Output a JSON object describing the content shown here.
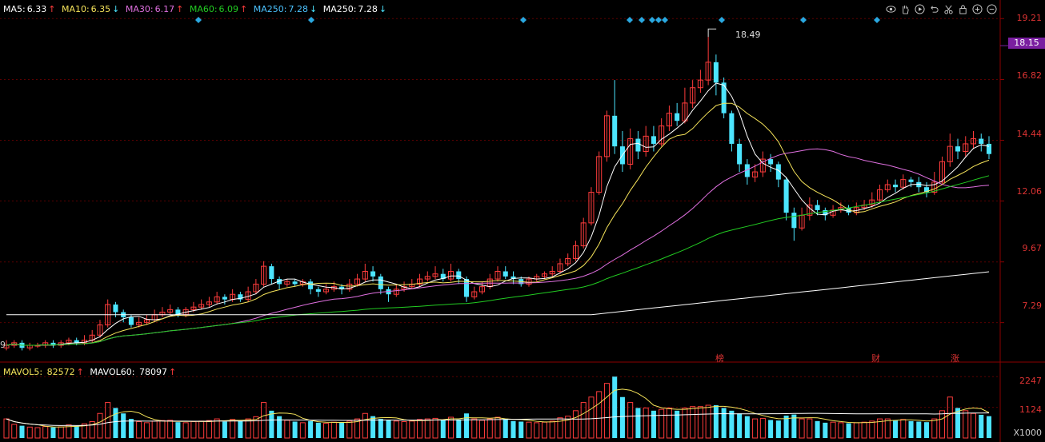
{
  "legend_top": {
    "ma5": {
      "label": "MA5:",
      "value": "6.33",
      "arrow": "↑",
      "color": "#ffffff"
    },
    "ma10": {
      "label": "MA10:",
      "value": "6.35",
      "arrow": "↓",
      "color": "#f5e35a"
    },
    "ma30": {
      "label": "MA30:",
      "value": "6.17",
      "arrow": "↑",
      "color": "#e070e0"
    },
    "ma60": {
      "label": "MA60:",
      "value": "6.09",
      "arrow": "↑",
      "color": "#22cc22"
    },
    "ma250a": {
      "label": "MA250:",
      "value": "7.28",
      "arrow": "↓",
      "color": "#4cc3ff"
    },
    "ma250b": {
      "label": "MA250:",
      "value": "7.28",
      "arrow": "↓",
      "color": "#ffffff"
    }
  },
  "legend_vol": {
    "mavol5": {
      "label": "MAVOL5:",
      "value": "82572",
      "arrow": "↑",
      "color": "#f5e35a"
    },
    "mavol60": {
      "label": "MAVOL60:",
      "value": "78097",
      "arrow": "↑",
      "color": "#ffffff"
    }
  },
  "price_axis": [
    "19.21",
    "16.82",
    "14.44",
    "12.06",
    "9.67",
    "7.29"
  ],
  "current_price": "18.15",
  "high_label": "18.49",
  "left_edge_label": "9",
  "volume_axis": [
    "2247",
    "1124"
  ],
  "volume_unit": "X1000",
  "event_markers": [
    "榜",
    "财",
    "涨"
  ],
  "toolbar_icons": [
    "eye-icon",
    "hand-icon",
    "play-icon",
    "undo-icon",
    "scissors-icon",
    "lock-icon",
    "zoom-in-icon",
    "zoom-out-icon"
  ],
  "colors": {
    "up": "#ff3c3c",
    "down": "#4ce5ff",
    "grid": "#5a0000",
    "axis": "#8b0000"
  },
  "chart_data": {
    "type": "candlestick",
    "price_range": [
      5.9,
      19.5
    ],
    "volume_range": [
      0,
      2400
    ],
    "candles": [
      [
        6.3,
        6.4,
        6.6,
        6.2,
        700
      ],
      [
        6.4,
        6.5,
        6.6,
        6.3,
        500
      ],
      [
        6.5,
        6.3,
        6.6,
        6.2,
        450
      ],
      [
        6.3,
        6.4,
        6.5,
        6.2,
        400
      ],
      [
        6.4,
        6.4,
        6.5,
        6.3,
        380
      ],
      [
        6.4,
        6.5,
        6.6,
        6.3,
        420
      ],
      [
        6.5,
        6.4,
        6.6,
        6.3,
        390
      ],
      [
        6.4,
        6.5,
        6.6,
        6.3,
        410
      ],
      [
        6.5,
        6.6,
        6.7,
        6.4,
        480
      ],
      [
        6.6,
        6.5,
        6.7,
        6.4,
        430
      ],
      [
        6.5,
        6.6,
        6.8,
        6.4,
        520
      ],
      [
        6.6,
        6.8,
        7.0,
        6.5,
        600
      ],
      [
        6.8,
        7.2,
        7.4,
        6.7,
        900
      ],
      [
        7.2,
        8.0,
        8.2,
        7.1,
        1300
      ],
      [
        8.0,
        7.7,
        8.1,
        7.5,
        1100
      ],
      [
        7.7,
        7.5,
        7.8,
        7.3,
        900
      ],
      [
        7.5,
        7.2,
        7.6,
        7.1,
        700
      ],
      [
        7.2,
        7.3,
        7.5,
        7.1,
        600
      ],
      [
        7.3,
        7.4,
        7.6,
        7.2,
        560
      ],
      [
        7.4,
        7.6,
        7.8,
        7.3,
        620
      ],
      [
        7.6,
        7.7,
        7.9,
        7.5,
        640
      ],
      [
        7.7,
        7.8,
        8.0,
        7.6,
        650
      ],
      [
        7.8,
        7.6,
        7.9,
        7.5,
        580
      ],
      [
        7.6,
        7.8,
        7.9,
        7.5,
        560
      ],
      [
        7.8,
        7.9,
        8.1,
        7.7,
        600
      ],
      [
        7.9,
        8.0,
        8.2,
        7.8,
        620
      ],
      [
        8.0,
        8.1,
        8.3,
        7.9,
        640
      ],
      [
        8.1,
        8.3,
        8.5,
        8.0,
        700
      ],
      [
        8.3,
        8.2,
        8.4,
        8.0,
        600
      ],
      [
        8.2,
        8.4,
        8.6,
        8.1,
        680
      ],
      [
        8.4,
        8.2,
        8.5,
        8.1,
        620
      ],
      [
        8.2,
        8.5,
        8.7,
        8.1,
        700
      ],
      [
        8.5,
        8.8,
        9.0,
        8.4,
        780
      ],
      [
        8.8,
        9.5,
        9.7,
        8.7,
        1300
      ],
      [
        9.5,
        9.0,
        9.6,
        8.8,
        1000
      ],
      [
        9.0,
        8.8,
        9.1,
        8.6,
        800
      ],
      [
        8.8,
        8.9,
        9.0,
        8.7,
        650
      ],
      [
        8.9,
        8.8,
        9.0,
        8.7,
        600
      ],
      [
        8.8,
        8.9,
        9.0,
        8.7,
        560
      ],
      [
        8.9,
        8.6,
        9.0,
        8.4,
        620
      ],
      [
        8.6,
        8.5,
        8.7,
        8.3,
        560
      ],
      [
        8.5,
        8.6,
        8.8,
        8.4,
        540
      ],
      [
        8.6,
        8.7,
        8.9,
        8.5,
        580
      ],
      [
        8.7,
        8.6,
        8.8,
        8.4,
        560
      ],
      [
        8.6,
        8.8,
        9.0,
        8.5,
        620
      ],
      [
        8.8,
        9.0,
        9.2,
        8.7,
        700
      ],
      [
        9.0,
        9.3,
        9.6,
        8.9,
        900
      ],
      [
        9.3,
        9.1,
        9.5,
        8.9,
        800
      ],
      [
        9.1,
        8.6,
        9.2,
        8.4,
        700
      ],
      [
        8.6,
        8.4,
        8.7,
        8.1,
        650
      ],
      [
        8.4,
        8.6,
        8.8,
        8.3,
        620
      ],
      [
        8.6,
        8.7,
        8.9,
        8.5,
        600
      ],
      [
        8.7,
        8.8,
        9.0,
        8.6,
        620
      ],
      [
        8.8,
        9.0,
        9.2,
        8.7,
        680
      ],
      [
        9.0,
        9.1,
        9.3,
        8.9,
        700
      ],
      [
        9.1,
        9.2,
        9.5,
        9.0,
        720
      ],
      [
        9.2,
        9.0,
        9.4,
        8.9,
        650
      ],
      [
        9.0,
        9.3,
        9.6,
        8.9,
        760
      ],
      [
        9.3,
        9.0,
        9.4,
        8.8,
        680
      ],
      [
        9.0,
        8.3,
        9.1,
        8.1,
        900
      ],
      [
        8.3,
        8.5,
        8.7,
        8.2,
        700
      ],
      [
        8.5,
        8.7,
        8.9,
        8.4,
        650
      ],
      [
        8.7,
        9.0,
        9.2,
        8.6,
        700
      ],
      [
        9.0,
        9.3,
        9.5,
        8.9,
        760
      ],
      [
        9.3,
        9.1,
        9.5,
        9.0,
        700
      ],
      [
        9.1,
        9.0,
        9.3,
        8.8,
        620
      ],
      [
        9.0,
        8.8,
        9.1,
        8.7,
        600
      ],
      [
        8.8,
        9.0,
        9.1,
        8.7,
        580
      ],
      [
        9.0,
        9.1,
        9.2,
        8.9,
        560
      ],
      [
        9.1,
        9.2,
        9.3,
        9.0,
        580
      ],
      [
        9.2,
        9.3,
        9.5,
        9.1,
        620
      ],
      [
        9.3,
        9.6,
        9.8,
        9.2,
        740
      ],
      [
        9.6,
        9.8,
        10.0,
        9.5,
        800
      ],
      [
        9.8,
        10.3,
        10.5,
        9.7,
        1000
      ],
      [
        10.3,
        11.2,
        11.4,
        10.2,
        1300
      ],
      [
        11.2,
        12.4,
        12.6,
        11.1,
        1500
      ],
      [
        12.4,
        13.8,
        14.0,
        12.3,
        1700
      ],
      [
        13.8,
        15.4,
        15.6,
        13.6,
        2000
      ],
      [
        15.4,
        14.2,
        16.8,
        13.9,
        2247
      ],
      [
        14.2,
        13.5,
        14.8,
        13.2,
        1500
      ],
      [
        13.5,
        14.5,
        14.9,
        13.3,
        1300
      ],
      [
        14.5,
        14.0,
        14.8,
        13.7,
        1100
      ],
      [
        14.0,
        14.6,
        15.0,
        13.8,
        1100
      ],
      [
        14.6,
        14.3,
        15.0,
        14.0,
        1000
      ],
      [
        14.3,
        15.0,
        15.3,
        14.2,
        1050
      ],
      [
        15.0,
        15.5,
        15.8,
        14.8,
        1100
      ],
      [
        15.5,
        15.2,
        15.9,
        15.0,
        1000
      ],
      [
        15.2,
        15.9,
        16.5,
        15.1,
        1100
      ],
      [
        15.9,
        16.5,
        16.8,
        15.7,
        1150
      ],
      [
        16.5,
        16.8,
        17.2,
        16.3,
        1150
      ],
      [
        16.8,
        17.5,
        18.49,
        16.6,
        1200
      ],
      [
        17.5,
        16.7,
        17.8,
        16.2,
        1200
      ],
      [
        16.7,
        15.5,
        16.9,
        15.3,
        1100
      ],
      [
        15.5,
        14.3,
        15.6,
        14.0,
        1000
      ],
      [
        14.3,
        13.5,
        14.5,
        13.2,
        900
      ],
      [
        13.5,
        13.0,
        13.7,
        12.7,
        800
      ],
      [
        13.0,
        13.2,
        13.5,
        12.8,
        700
      ],
      [
        13.2,
        13.7,
        14.0,
        13.0,
        720
      ],
      [
        13.7,
        13.5,
        13.9,
        13.2,
        660
      ],
      [
        13.5,
        12.9,
        13.6,
        12.6,
        640
      ],
      [
        12.9,
        11.6,
        13.0,
        11.3,
        820
      ],
      [
        11.6,
        11.0,
        11.8,
        10.5,
        860
      ],
      [
        11.0,
        11.5,
        11.8,
        10.9,
        700
      ],
      [
        11.5,
        11.9,
        12.2,
        11.3,
        700
      ],
      [
        11.9,
        11.7,
        12.1,
        11.5,
        620
      ],
      [
        11.7,
        11.5,
        11.8,
        11.3,
        560
      ],
      [
        11.5,
        11.7,
        11.9,
        11.4,
        580
      ],
      [
        11.7,
        11.8,
        12.0,
        11.6,
        560
      ],
      [
        11.8,
        11.6,
        11.9,
        11.5,
        540
      ],
      [
        11.6,
        11.8,
        12.0,
        11.5,
        560
      ],
      [
        11.8,
        11.9,
        12.1,
        11.7,
        580
      ],
      [
        11.9,
        12.1,
        12.4,
        11.8,
        620
      ],
      [
        12.1,
        12.5,
        12.7,
        12.0,
        700
      ],
      [
        12.5,
        12.7,
        12.9,
        12.4,
        700
      ],
      [
        12.7,
        12.6,
        12.9,
        12.4,
        640
      ],
      [
        12.6,
        12.9,
        13.1,
        12.5,
        680
      ],
      [
        12.9,
        12.8,
        13.0,
        12.6,
        620
      ],
      [
        12.8,
        12.6,
        13.0,
        12.4,
        600
      ],
      [
        12.6,
        12.4,
        12.8,
        12.2,
        580
      ],
      [
        12.4,
        12.8,
        13.2,
        12.3,
        700
      ],
      [
        12.8,
        13.6,
        13.8,
        12.7,
        1000
      ],
      [
        13.6,
        14.2,
        14.7,
        13.4,
        1500
      ],
      [
        14.2,
        14.0,
        14.5,
        13.7,
        1100
      ],
      [
        14.0,
        14.3,
        14.6,
        13.8,
        1000
      ],
      [
        14.3,
        14.5,
        14.8,
        14.1,
        900
      ],
      [
        14.5,
        14.3,
        14.7,
        14.0,
        850
      ],
      [
        14.3,
        13.9,
        14.6,
        13.7,
        800
      ]
    ]
  }
}
